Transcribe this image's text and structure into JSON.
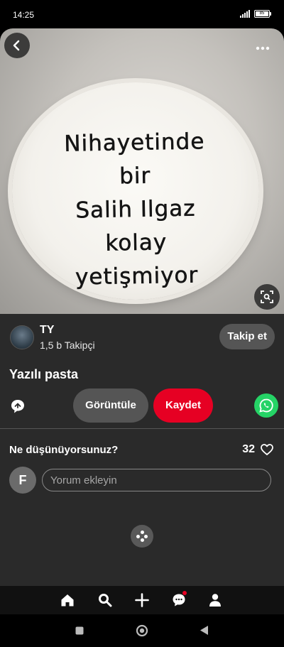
{
  "status": {
    "time": "14:25",
    "battery": "85"
  },
  "pin": {
    "cake_text_lines": [
      "Nihayetinde",
      "bir",
      "Salih Ilgaz",
      "kolay",
      "yetişmiyor"
    ],
    "title": "Yazılı pasta"
  },
  "creator": {
    "name": "TY",
    "followers": "1,5 b Takipçi",
    "follow_label": "Takip et"
  },
  "actions": {
    "view_label": "Görüntüle",
    "save_label": "Kaydet"
  },
  "comments": {
    "heading": "Ne düşünüyorsunuz?",
    "like_count": "32",
    "user_initial": "F",
    "input_placeholder": "Yorum ekleyin"
  },
  "colors": {
    "accent": "#e60023",
    "whatsapp": "#25d366",
    "panel": "#2a2a2a"
  },
  "icons": [
    "back-icon",
    "more-icon",
    "visual-search-icon",
    "share-icon",
    "whatsapp-icon",
    "heart-icon",
    "home-icon",
    "search-icon",
    "create-icon",
    "messages-icon",
    "profile-icon"
  ]
}
